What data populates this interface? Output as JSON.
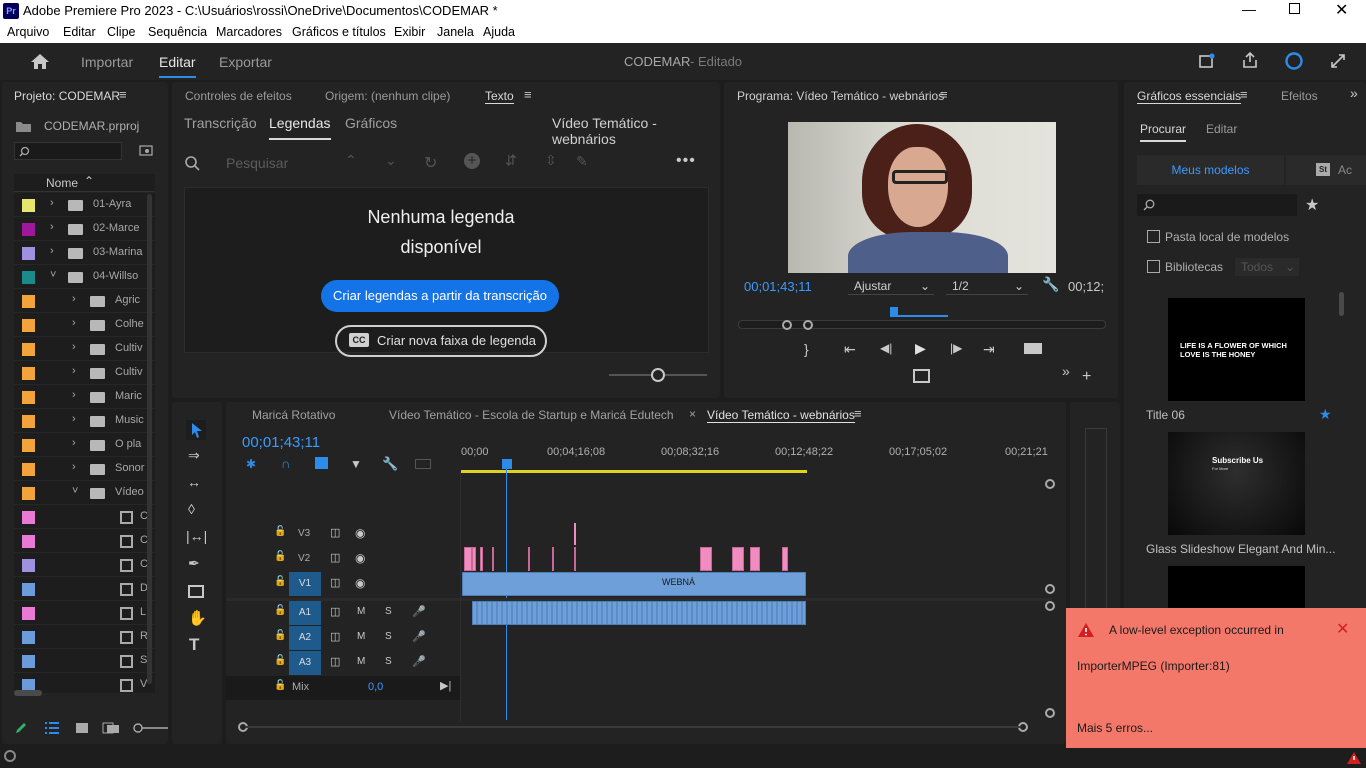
{
  "titlebar": {
    "title": "Adobe Premiere Pro 2023 - C:\\Usuários\\rossi\\OneDrive\\Documentos\\CODEMAR *",
    "logo": "Pr"
  },
  "menu": [
    "Arquivo",
    "Editar",
    "Clipe",
    "Sequência",
    "Marcadores",
    "Gráficos e títulos",
    "Exibir",
    "Janela",
    "Ajuda"
  ],
  "header": {
    "import": "Importar",
    "edit": "Editar",
    "export": "Exportar",
    "project_title": "CODEMAR",
    "project_status": "- Editado"
  },
  "project": {
    "title": "Projeto: CODEMAR",
    "file": "CODEMAR.prproj",
    "name_col": "Nome",
    "items": [
      {
        "label": "01-Ayra",
        "color": "#e6e66e"
      },
      {
        "label": "02-Marce",
        "color": "#a0189a"
      },
      {
        "label": "03-Marina",
        "color": "#9f90e0"
      },
      {
        "label": "04-Willso",
        "color": "#1a8a8a"
      },
      {
        "label": "Agric",
        "color": "#f2a33c"
      },
      {
        "label": "Colhe",
        "color": "#f2a33c"
      },
      {
        "label": "Cultiv",
        "color": "#f2a33c"
      },
      {
        "label": "Cultiv",
        "color": "#f2a33c"
      },
      {
        "label": "Maric",
        "color": "#f2a33c"
      },
      {
        "label": "Music",
        "color": "#f2a33c"
      },
      {
        "label": "O pla",
        "color": "#f2a33c"
      },
      {
        "label": "Sonor",
        "color": "#f2a33c"
      },
      {
        "label": "Vídeo",
        "color": "#f2a33c"
      },
      {
        "label": "C",
        "color": "#e87ad6"
      },
      {
        "label": "C",
        "color": "#e87ad6"
      },
      {
        "label": "C",
        "color": "#9f90e0"
      },
      {
        "label": "D",
        "color": "#6b9bd8"
      },
      {
        "label": "L",
        "color": "#e87ad6"
      },
      {
        "label": "R",
        "color": "#6b9bd8"
      },
      {
        "label": "S",
        "color": "#6b9bd8"
      },
      {
        "label": "V",
        "color": "#6b9bd8"
      }
    ]
  },
  "source": {
    "tabs": [
      "Controles de efeitos",
      "Origem: (nenhum clipe)",
      "Texto"
    ],
    "subtabs": [
      "Transcrição",
      "Legendas",
      "Gráficos"
    ],
    "seq_name": "Vídeo Temático - webnários",
    "search_placeholder": "Pesquisar",
    "empty_title_1": "Nenhuma legenda",
    "empty_title_2": "disponível",
    "create_from_transcript": "Criar legendas a partir da transcrição",
    "new_caption_track": "Criar nova faixa de legenda",
    "cc": "CC"
  },
  "program": {
    "title": "Programa: Vídeo Temático - webnários",
    "timecode": "00;01;43;11",
    "fit": "Ajustar",
    "resolution": "1/2",
    "duration": "00;12;"
  },
  "graphics": {
    "tabs": [
      "Gráficos essenciais",
      "Efeitos"
    ],
    "subtabs": [
      "Procurar",
      "Editar"
    ],
    "my_templates": "Meus modelos",
    "st": "St",
    "ac": "Ac",
    "local_folder": "Pasta local de modelos",
    "libraries": "Bibliotecas",
    "all": "Todos",
    "t1_name": "Title 06",
    "t1_text": "LIFE IS A FLOWER OF WHICH LOVE IS THE HONEY",
    "t2_name": "Glass Slideshow Elegant And Min...",
    "t2_text": "Subscribe Us",
    "t2_sub": "For More"
  },
  "timeline": {
    "tabs": [
      "Maricá Rotativo",
      "Vídeo Temático - Escola de Startup e Maricá Edutech",
      "Vídeo Temático - webnários"
    ],
    "timecode": "00;01;43;11",
    "ruler": [
      "00;00",
      "00;04;16;08",
      "00;08;32;16",
      "00;12;48;22",
      "00;17;05;02",
      "00;21;21"
    ],
    "video_tracks": [
      "V3",
      "V2",
      "V1"
    ],
    "audio_tracks": [
      "A1",
      "A2",
      "A3"
    ],
    "mix": "Mix",
    "mix_val": "0,0",
    "clip_label": "WEBNÁ",
    "m": "M",
    "s": "S"
  },
  "error": {
    "title": "A low-level exception occurred in",
    "body": "ImporterMPEG (Importer:81)",
    "more": "Mais 5 erros..."
  },
  "colors": {
    "accent": "#2d8ceb",
    "panel": "#232323",
    "error": "#f4786a",
    "pink": "#f08cc0",
    "clip": "#6f9fd8"
  }
}
